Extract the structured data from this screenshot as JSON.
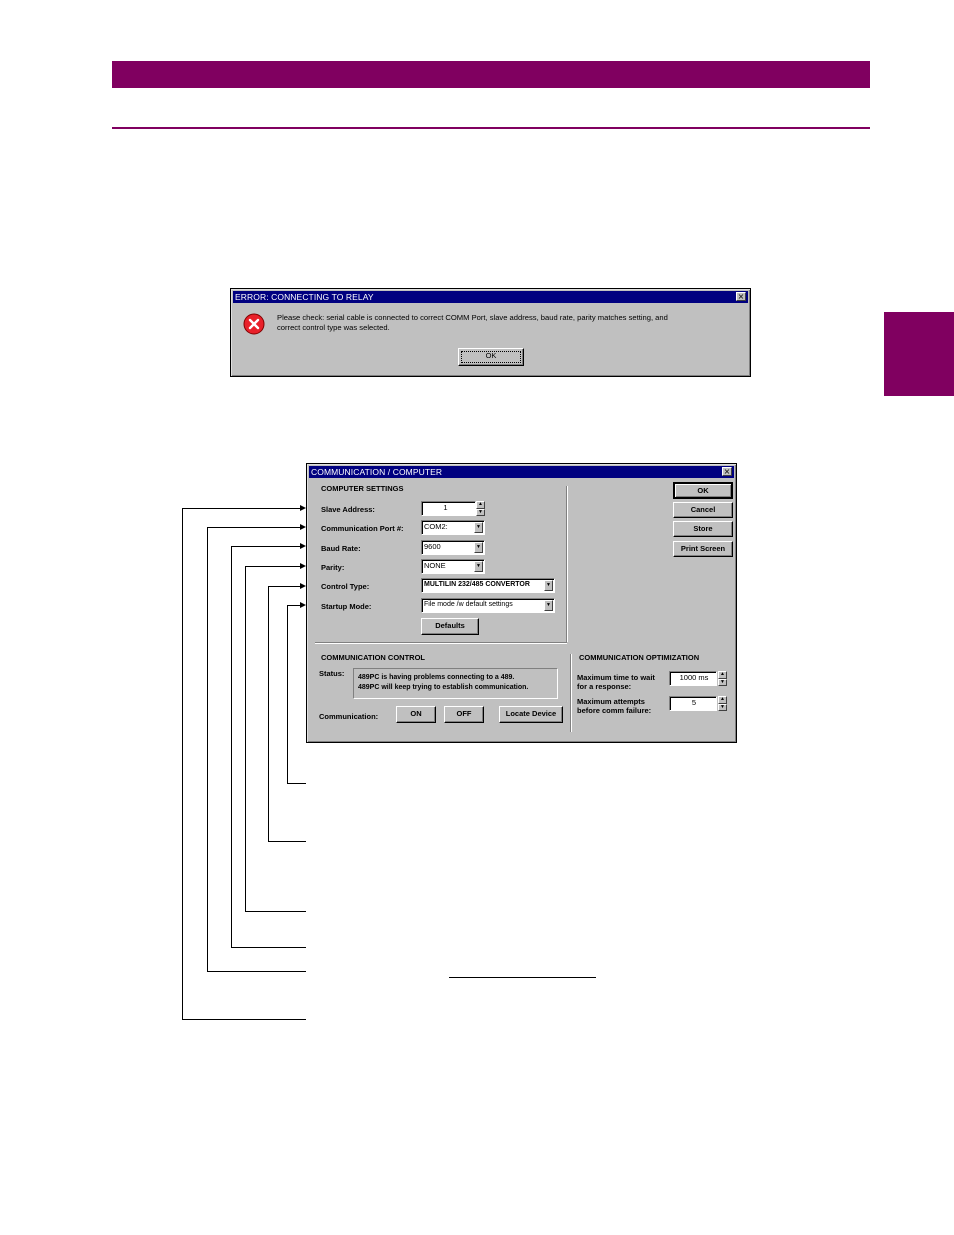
{
  "error_dialog": {
    "title": "ERROR: CONNECTING TO RELAY",
    "close": "×",
    "icon": "error-icon",
    "message_line1": "Please check: serial cable is connected to correct COMM Port, slave address, baud rate, parity matches setting, and",
    "message_line2": "correct control type was selected.",
    "ok_label": "OK"
  },
  "comm_dialog": {
    "title": "COMMUNICATION  /  COMPUTER",
    "close": "×",
    "computer_settings_heading": "COMPUTER SETTINGS",
    "fields": {
      "slave_address": {
        "label": "Slave Address:",
        "value": "1"
      },
      "comm_port": {
        "label": "Communication Port #:",
        "value": "COM2:"
      },
      "baud_rate": {
        "label": "Baud Rate:",
        "value": "9600"
      },
      "parity": {
        "label": "Parity:",
        "value": "NONE"
      },
      "control_type": {
        "label": "Control Type:",
        "value": "MULTILIN 232/485 CONVERTOR"
      },
      "startup_mode": {
        "label": "Startup Mode:",
        "value": "File mode /w default settings"
      }
    },
    "defaults_label": "Defaults",
    "buttons": {
      "ok": "OK",
      "cancel": "Cancel",
      "store": "Store",
      "print": "Print Screen"
    },
    "comm_control": {
      "heading": "COMMUNICATION CONTROL",
      "status_label": "Status:",
      "status_line1": "489PC is having problems connecting to a 489.",
      "status_line2": "489PC will keep trying to establish communication.",
      "communication_label": "Communication:",
      "on_label": "ON",
      "off_label": "OFF",
      "locate_label": "Locate Device"
    },
    "comm_opt": {
      "heading": "COMMUNICATION OPTIMIZATION",
      "max_wait_line1": "Maximum time to wait",
      "max_wait_line2": "for a response:",
      "max_wait_value": "1000 ms",
      "max_attempts_line1": "Maximum attempts",
      "max_attempts_line2": "before comm failure:",
      "max_attempts_value": "5"
    }
  },
  "colors": {
    "brand": "#800060",
    "titlebar": "#000080",
    "face": "#c0c0c0"
  }
}
